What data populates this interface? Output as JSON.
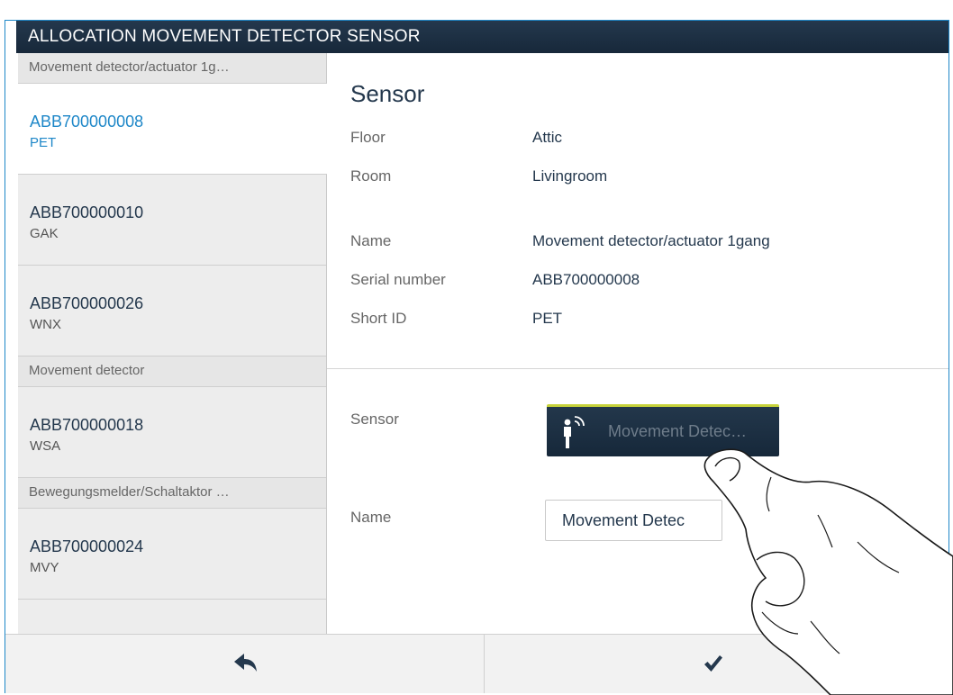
{
  "window": {
    "title": "ALLOCATION MOVEMENT DETECTOR SENSOR"
  },
  "sidebar": {
    "groups": [
      {
        "label": "Movement detector/actuator 1g…",
        "items": [
          {
            "serial": "ABB700000008",
            "short_id": "PET",
            "selected": true
          },
          {
            "serial": "ABB700000010",
            "short_id": "GAK"
          },
          {
            "serial": "ABB700000026",
            "short_id": "WNX"
          }
        ]
      },
      {
        "label": "Movement detector",
        "items": [
          {
            "serial": "ABB700000018",
            "short_id": "WSA"
          }
        ]
      },
      {
        "label": "Bewegungsmelder/Schaltaktor …",
        "items": [
          {
            "serial": "ABB700000024",
            "short_id": "MVY"
          }
        ]
      }
    ]
  },
  "details": {
    "title": "Sensor",
    "floor_label": "Floor",
    "floor_value": "Attic",
    "room_label": "Room",
    "room_value": "Livingroom",
    "name_label": "Name",
    "name_value": "Movement detector/actuator 1gang",
    "serial_label": "Serial number",
    "serial_value": "ABB700000008",
    "shortid_label": "Short ID",
    "shortid_value": "PET"
  },
  "assignment": {
    "sensor_label": "Sensor",
    "sensor_button_label": "Movement Detec…",
    "sensor_icon": "person-with-signal-icon",
    "name_label": "Name",
    "name_input_value": "Movement Detec"
  },
  "footer": {
    "back_icon": "back-arrow-icon",
    "confirm_icon": "checkmark-icon"
  },
  "colors": {
    "title_bg": "#1b2d40",
    "accent": "#1e87c8",
    "button_top": "#c6d23a"
  }
}
